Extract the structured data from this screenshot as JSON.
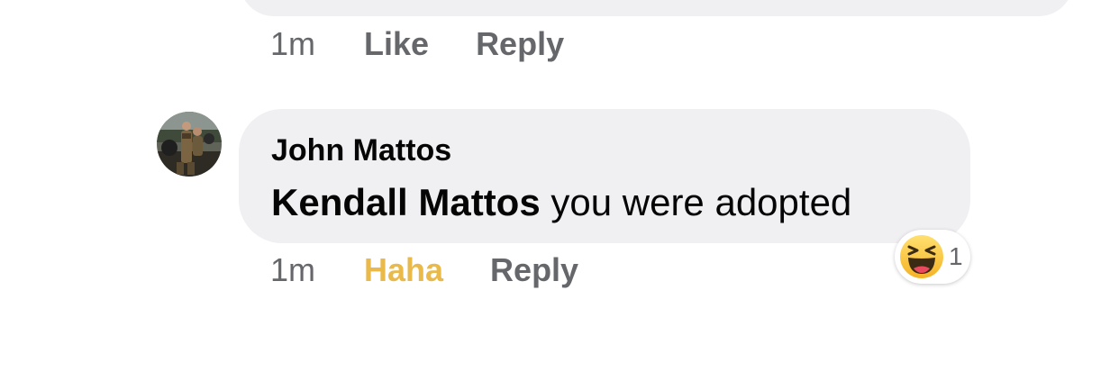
{
  "previous_comment": {
    "timestamp": "1m",
    "like_label": "Like",
    "reply_label": "Reply"
  },
  "comment": {
    "author": "John Mattos",
    "mention": "Kendall Mattos",
    "text": " you were adopted",
    "timestamp": "1m",
    "reaction_label": "Haha",
    "reply_label": "Reply",
    "reaction_badge": {
      "icon": "haha-emoji-icon",
      "count": "1"
    }
  },
  "colors": {
    "bubble": "#f0f0f3",
    "secondary_text": "#65676b",
    "haha_accent": "#e9b949",
    "primary_text": "#050505"
  }
}
